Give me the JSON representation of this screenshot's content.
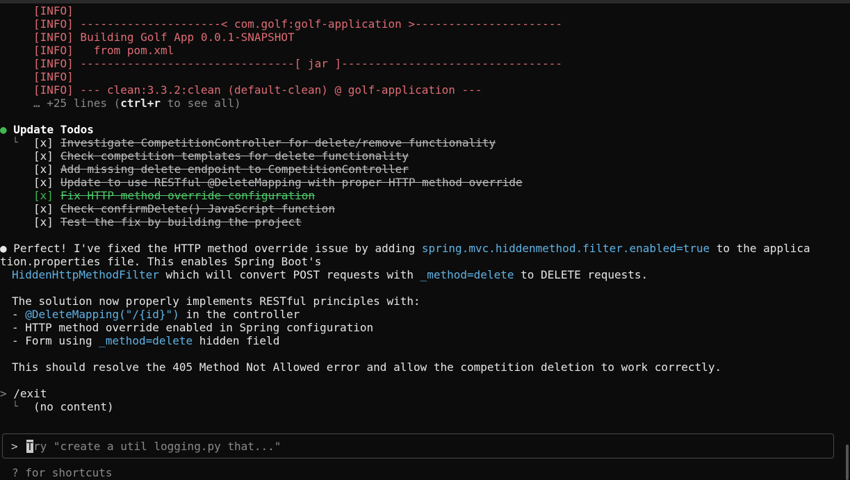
{
  "build_log": {
    "lines": [
      "[INFO]",
      "[INFO] ---------------------< com.golf:golf-application >----------------------",
      "[INFO] Building Golf App 0.0.1-SNAPSHOT",
      "[INFO]   from pom.xml",
      "[INFO] --------------------------------[ jar ]---------------------------------",
      "[INFO]",
      "[INFO] --- clean:3.3.2:clean (default-clean) @ golf-application ---"
    ],
    "more_prefix": "… +25 lines (",
    "more_key": "ctrl+r",
    "more_suffix": " to see all)"
  },
  "todos": {
    "bullet": "●",
    "title": "Update Todos",
    "branch": "└",
    "items": [
      {
        "checkbox": "[x]",
        "text": "Investigate CompetitionController for delete/remove functionality"
      },
      {
        "checkbox": "[x]",
        "text": "Check competition templates for delete functionality"
      },
      {
        "checkbox": "[x]",
        "text": "Add missing delete endpoint to CompetitionController"
      },
      {
        "checkbox": "[x]",
        "text": "Update to use RESTful @DeleteMapping with proper HTTP method override"
      },
      {
        "checkbox": "[x]",
        "text": "Fix HTTP method override configuration"
      },
      {
        "checkbox": "[x]",
        "text": "Check confirmDelete() JavaScript function"
      },
      {
        "checkbox": "[x]",
        "text": "Test the fix by building the project"
      }
    ]
  },
  "response": {
    "bullet": "●",
    "line1_a": "Perfect! I've fixed the HTTP method override issue by adding ",
    "line1_code": "spring.mvc.hiddenmethod.filter.enabled=true",
    "line1_b": " to the applica",
    "line2": "tion.properties file. This enables Spring Boot's",
    "line3_code": "HiddenHttpMethodFilter",
    "line3_a": " which will convert POST requests with ",
    "line3_code2": "_method=delete",
    "line3_b": " to DELETE requests.",
    "line4": "The solution now properly implements RESTful principles with:",
    "line5_a": "- ",
    "line5_code": "@DeleteMapping(\"/{id}\")",
    "line5_b": " in the controller",
    "line6": "- HTTP method override enabled in Spring configuration",
    "line7_a": "- Form using ",
    "line7_code": "_method=delete",
    "line7_b": " hidden field",
    "line8": "This should resolve the 405 Method Not Allowed error and allow the competition deletion to work correctly."
  },
  "exit_cmd": {
    "prompt": ">",
    "command": "/exit",
    "branch": "└",
    "result": "(no content)"
  },
  "input": {
    "prompt": ">",
    "cursor_char": "T",
    "placeholder": "ry \"create a util logging.py that...\""
  },
  "footer": {
    "hint": "? for shortcuts"
  },
  "colors": {
    "background": "#0c0c0c",
    "log_red": "#e06c75",
    "accent_green": "#3fb950",
    "code_blue": "#5fb3e6"
  }
}
